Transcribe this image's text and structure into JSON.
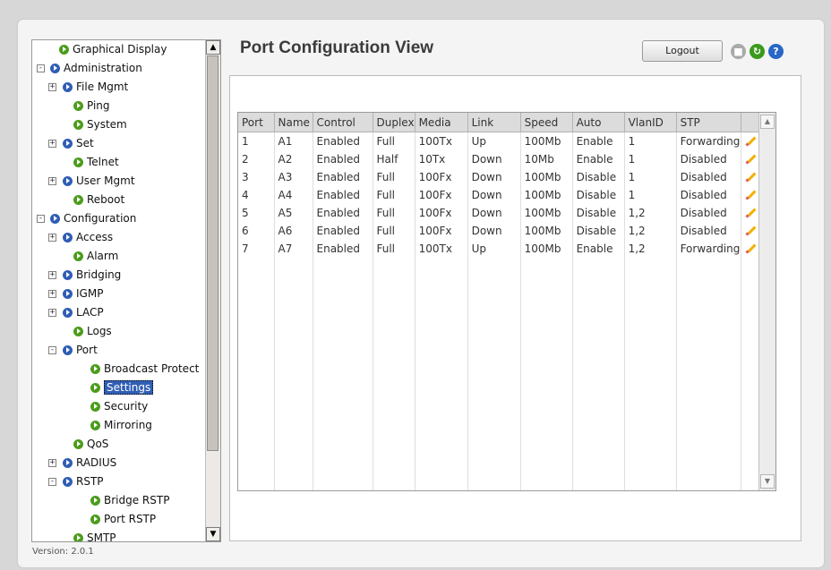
{
  "sidebar": {
    "items": [
      {
        "label": "Graphical Display",
        "level": 0,
        "expander": "",
        "icon": "green"
      },
      {
        "label": "Administration",
        "level": 0,
        "expander": "−",
        "icon": "blue"
      },
      {
        "label": "File Mgmt",
        "level": 1,
        "expander": "+",
        "icon": "blue"
      },
      {
        "label": "Ping",
        "level": 1,
        "expander": "",
        "icon": "green"
      },
      {
        "label": "System",
        "level": 1,
        "expander": "",
        "icon": "green"
      },
      {
        "label": "Set",
        "level": 1,
        "expander": "+",
        "icon": "blue"
      },
      {
        "label": "Telnet",
        "level": 1,
        "expander": "",
        "icon": "green"
      },
      {
        "label": "User Mgmt",
        "level": 1,
        "expander": "+",
        "icon": "blue"
      },
      {
        "label": "Reboot",
        "level": 1,
        "expander": "",
        "icon": "green"
      },
      {
        "label": "Configuration",
        "level": 0,
        "expander": "−",
        "icon": "blue"
      },
      {
        "label": "Access",
        "level": 1,
        "expander": "+",
        "icon": "blue"
      },
      {
        "label": "Alarm",
        "level": 1,
        "expander": "",
        "icon": "green"
      },
      {
        "label": "Bridging",
        "level": 1,
        "expander": "+",
        "icon": "blue"
      },
      {
        "label": "IGMP",
        "level": 1,
        "expander": "+",
        "icon": "blue"
      },
      {
        "label": "LACP",
        "level": 1,
        "expander": "+",
        "icon": "blue"
      },
      {
        "label": "Logs",
        "level": 1,
        "expander": "",
        "icon": "green"
      },
      {
        "label": "Port",
        "level": 1,
        "expander": "−",
        "icon": "blue"
      },
      {
        "label": "Broadcast Protect",
        "level": 2,
        "expander": "",
        "icon": "green"
      },
      {
        "label": "Settings",
        "level": 2,
        "expander": "",
        "icon": "green",
        "selected": true
      },
      {
        "label": "Security",
        "level": 2,
        "expander": "",
        "icon": "green"
      },
      {
        "label": "Mirroring",
        "level": 2,
        "expander": "",
        "icon": "green"
      },
      {
        "label": "QoS",
        "level": 1,
        "expander": "",
        "icon": "green"
      },
      {
        "label": "RADIUS",
        "level": 1,
        "expander": "+",
        "icon": "blue"
      },
      {
        "label": "RSTP",
        "level": 1,
        "expander": "−",
        "icon": "blue"
      },
      {
        "label": "Bridge RSTP",
        "level": 2,
        "expander": "",
        "icon": "green"
      },
      {
        "label": "Port RSTP",
        "level": 2,
        "expander": "",
        "icon": "green"
      },
      {
        "label": "SMTP",
        "level": 1,
        "expander": "",
        "icon": "green"
      }
    ]
  },
  "footer": {
    "version": "Version: 2.0.1"
  },
  "header": {
    "title": "Port Configuration View",
    "logout_label": "Logout"
  },
  "icons": {
    "save": "save-icon",
    "refresh": "refresh-icon",
    "help": "help-icon"
  },
  "colors": {
    "selected": "#315fb5",
    "brand_blue": "#2f5db4",
    "brand_green": "#4c9c1c"
  },
  "table": {
    "columns": [
      "Port",
      "Name",
      "Control",
      "Duplex",
      "Media",
      "Link",
      "Speed",
      "Auto",
      "VlanID",
      "STP",
      ""
    ],
    "rows": [
      [
        "1",
        "A1",
        "Enabled",
        "Full",
        "100Tx",
        "Up",
        "100Mb",
        "Enable",
        "1",
        "Forwarding"
      ],
      [
        "2",
        "A2",
        "Enabled",
        "Half",
        "10Tx",
        "Down",
        "10Mb",
        "Enable",
        "1",
        "Disabled"
      ],
      [
        "3",
        "A3",
        "Enabled",
        "Full",
        "100Fx",
        "Down",
        "100Mb",
        "Disable",
        "1",
        "Disabled"
      ],
      [
        "4",
        "A4",
        "Enabled",
        "Full",
        "100Fx",
        "Down",
        "100Mb",
        "Disable",
        "1",
        "Disabled"
      ],
      [
        "5",
        "A5",
        "Enabled",
        "Full",
        "100Fx",
        "Down",
        "100Mb",
        "Disable",
        "1,2",
        "Disabled"
      ],
      [
        "6",
        "A6",
        "Enabled",
        "Full",
        "100Fx",
        "Down",
        "100Mb",
        "Disable",
        "1,2",
        "Disabled"
      ],
      [
        "7",
        "A7",
        "Enabled",
        "Full",
        "100Tx",
        "Up",
        "100Mb",
        "Enable",
        "1,2",
        "Forwarding"
      ]
    ]
  }
}
